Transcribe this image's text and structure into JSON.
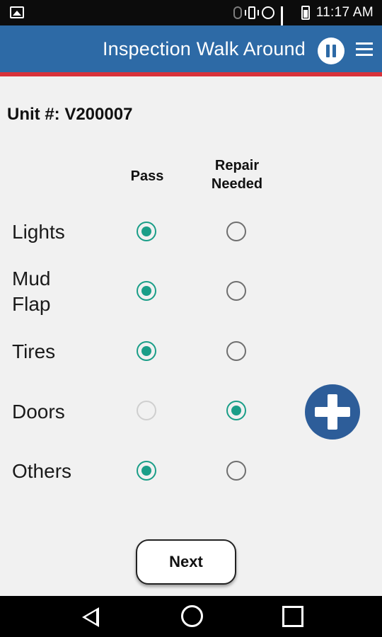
{
  "status_bar": {
    "time": "11:17 AM",
    "icons": [
      "gallery-icon",
      "bluetooth-icon",
      "vibrate-icon",
      "alarm-icon",
      "data-icon",
      "signal-icon",
      "battery-icon"
    ]
  },
  "app_bar": {
    "title": "Inspection Walk Around",
    "background": "#2d6aa6",
    "accent_line": "#d8323a",
    "icons": [
      "pause-icon",
      "menu-icon"
    ]
  },
  "unit": {
    "label": "Unit #: V200007"
  },
  "columns": {
    "pass": "Pass",
    "repair_line1": "Repair",
    "repair_line2": "Needed"
  },
  "items": [
    {
      "label": "Lights",
      "status": "pass"
    },
    {
      "label_line1": "Mud",
      "label_line2": "Flap",
      "status": "pass"
    },
    {
      "label": "Tires",
      "status": "pass"
    },
    {
      "label": "Doors",
      "status": "repair"
    },
    {
      "label": "Others",
      "status": "pass"
    }
  ],
  "add_button": {
    "icon": "plus-icon",
    "color": "#2d5d99"
  },
  "next_button": {
    "label": "Next"
  },
  "radio_checked_color": "#1a9e88",
  "nav_bar": {
    "icons": [
      "back-icon",
      "home-icon",
      "recent-apps-icon"
    ]
  }
}
